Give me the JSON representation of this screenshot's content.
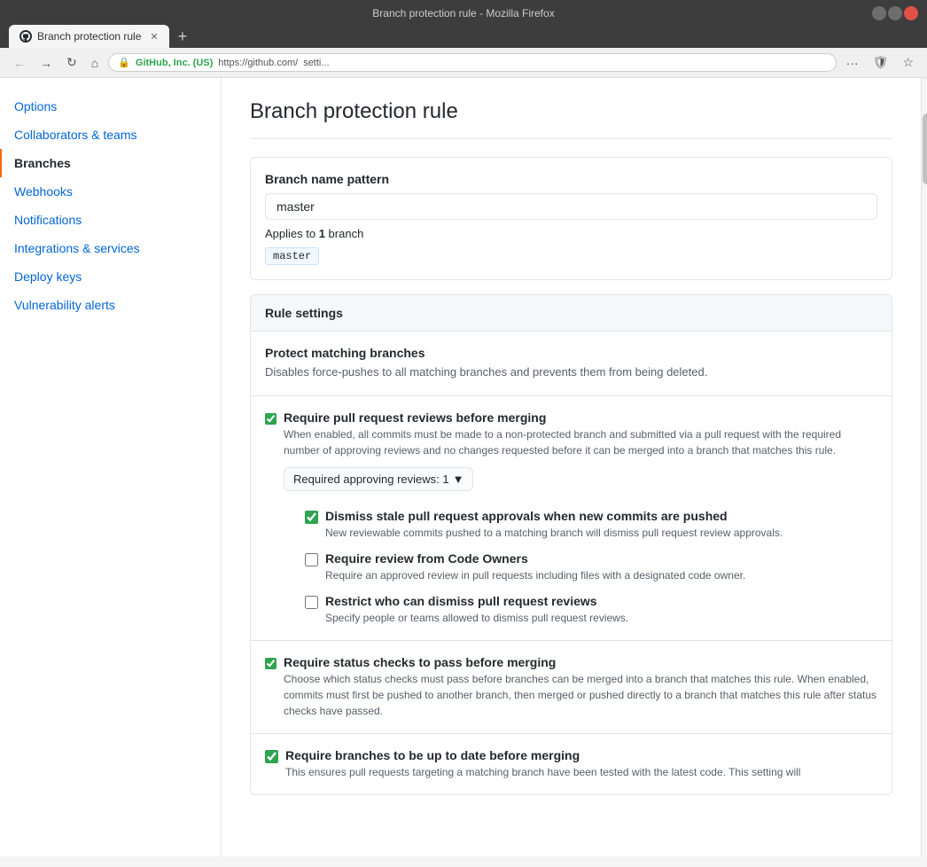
{
  "browser": {
    "title": "Branch protection rule - Mozilla Firefox",
    "tab_label": "Branch protection rule",
    "url_company": "GitHub, Inc. (US)",
    "url_text": "https://github.com/",
    "url_suffix": "setti..."
  },
  "sidebar": {
    "items": [
      {
        "id": "options",
        "label": "Options",
        "active": false
      },
      {
        "id": "collaborators",
        "label": "Collaborators & teams",
        "active": false
      },
      {
        "id": "branches",
        "label": "Branches",
        "active": true
      },
      {
        "id": "webhooks",
        "label": "Webhooks",
        "active": false
      },
      {
        "id": "notifications",
        "label": "Notifications",
        "active": false
      },
      {
        "id": "integrations",
        "label": "Integrations & services",
        "active": false
      },
      {
        "id": "deploy-keys",
        "label": "Deploy keys",
        "active": false
      },
      {
        "id": "vulnerability-alerts",
        "label": "Vulnerability alerts",
        "active": false
      }
    ]
  },
  "main": {
    "page_title": "Branch protection rule",
    "branch_name_section": {
      "field_label": "Branch name pattern",
      "field_value": "master",
      "applies_text_prefix": "Applies to ",
      "applies_count": "1",
      "applies_text_suffix": " branch",
      "branch_badge": "master"
    },
    "rule_settings": {
      "header": "Rule settings",
      "protect_section": {
        "title": "Protect matching branches",
        "desc": "Disables force-pushes to all matching branches and prevents them from being deleted."
      },
      "require_pr_section": {
        "checked": true,
        "label": "Require pull request reviews before merging",
        "desc": "When enabled, all commits must be made to a non-protected branch and submitted via a pull request with the required number of approving reviews and no changes requested before it can be merged into a branch that matches this rule.",
        "dropdown_label": "Required approving reviews: 1",
        "nested": [
          {
            "checked": true,
            "label": "Dismiss stale pull request approvals when new commits are pushed",
            "desc": "New reviewable commits pushed to a matching branch will dismiss pull request review approvals."
          },
          {
            "checked": false,
            "label": "Require review from Code Owners",
            "desc": "Require an approved review in pull requests including files with a designated code owner."
          },
          {
            "checked": false,
            "label": "Restrict who can dismiss pull request reviews",
            "desc": "Specify people or teams allowed to dismiss pull request reviews."
          }
        ]
      },
      "require_status_section": {
        "checked": true,
        "label": "Require status checks to pass before merging",
        "desc": "Choose which status checks must pass before branches can be merged into a branch that matches this rule. When enabled, commits must first be pushed to another branch, then merged or pushed directly to a branch that matches this rule after status checks have passed."
      },
      "require_uptodate_section": {
        "checked": true,
        "label": "Require branches to be up to date before merging",
        "desc": "This ensures pull requests targeting a matching branch have been tested with the latest code. This setting will"
      }
    }
  }
}
